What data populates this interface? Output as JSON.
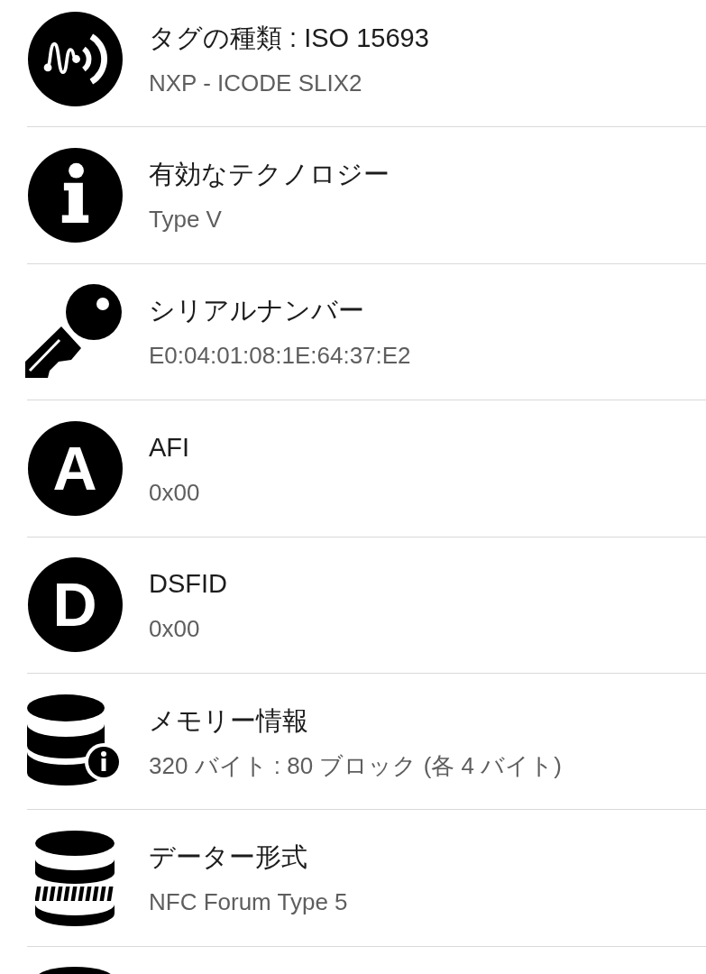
{
  "rows": [
    {
      "kind": "signal",
      "title": "タグの種類 : ISO 15693",
      "subtitle": "NXP - ICODE SLIX2"
    },
    {
      "kind": "info",
      "title": "有効なテクノロジー",
      "subtitle": "Type V"
    },
    {
      "kind": "key",
      "title": "シリアルナンバー",
      "subtitle": "E0:04:01:08:1E:64:37:E2"
    },
    {
      "kind": "letter",
      "letter": "A",
      "title": "AFI",
      "subtitle": "0x00"
    },
    {
      "kind": "letter",
      "letter": "D",
      "title": "DSFID",
      "subtitle": "0x00"
    },
    {
      "kind": "memory",
      "title": "メモリー情報",
      "subtitle": "320 バイト : 80 ブロック (各 4 バイト)"
    },
    {
      "kind": "format",
      "title": "データー形式",
      "subtitle": "NFC Forum Type 5"
    },
    {
      "kind": "cylinder"
    }
  ]
}
